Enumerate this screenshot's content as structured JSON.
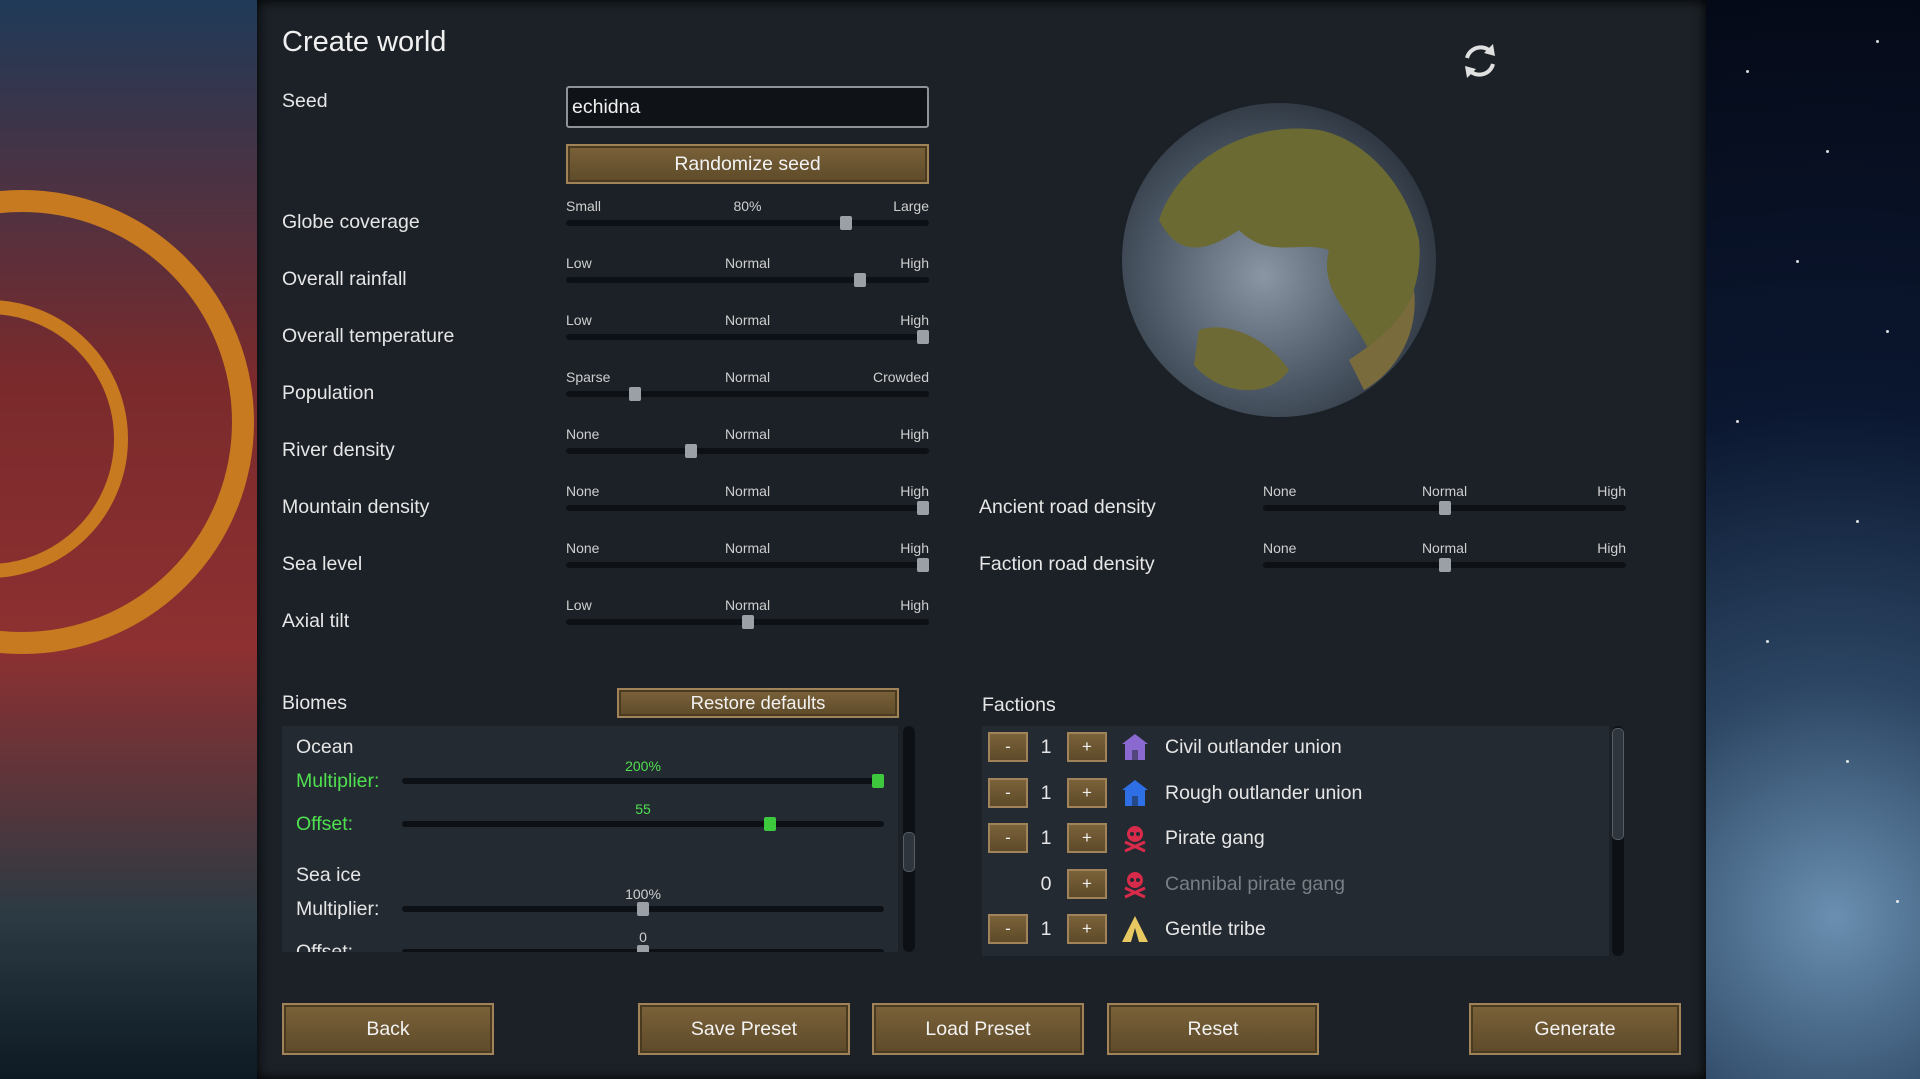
{
  "title": "Create world",
  "seed": {
    "label": "Seed",
    "value": "echidna",
    "randomize_label": "Randomize seed"
  },
  "sliders": [
    {
      "label": "Globe coverage",
      "low": "Small",
      "mid": "80%",
      "high": "Large",
      "value": 0.78
    },
    {
      "label": "Overall rainfall",
      "low": "Low",
      "mid": "Normal",
      "high": "High",
      "value": 0.82
    },
    {
      "label": "Overall temperature",
      "low": "Low",
      "mid": "Normal",
      "high": "High",
      "value": 1.0
    },
    {
      "label": "Population",
      "low": "Sparse",
      "mid": "Normal",
      "high": "Crowded",
      "value": 0.18
    },
    {
      "label": "River density",
      "low": "None",
      "mid": "Normal",
      "high": "High",
      "value": 0.34
    },
    {
      "label": "Mountain density",
      "low": "None",
      "mid": "Normal",
      "high": "High",
      "value": 1.0
    },
    {
      "label": "Sea level",
      "low": "None",
      "mid": "Normal",
      "high": "High",
      "value": 1.0
    },
    {
      "label": "Axial tilt",
      "low": "Low",
      "mid": "Normal",
      "high": "High",
      "value": 0.5
    }
  ],
  "road_sliders": [
    {
      "label": "Ancient road density",
      "low": "None",
      "mid": "Normal",
      "high": "High",
      "value": 0.5
    },
    {
      "label": "Faction road density",
      "low": "None",
      "mid": "Normal",
      "high": "High",
      "value": 0.5
    }
  ],
  "biomes": {
    "label": "Biomes",
    "restore_label": "Restore defaults",
    "items": [
      {
        "name": "Ocean",
        "multiplier_label": "Multiplier:",
        "multiplier_value": "200%",
        "multiplier_pos": 1.0,
        "offset_label": "Offset:",
        "offset_value": "55",
        "offset_pos": 0.77
      },
      {
        "name": "Sea ice",
        "multiplier_label": "Multiplier:",
        "multiplier_value": "100%",
        "multiplier_pos": 0.5,
        "offset_label": "Offset:",
        "offset_value": "0",
        "offset_pos": 0.5
      }
    ]
  },
  "factions": {
    "label": "Factions",
    "items": [
      {
        "name": "Civil outlander union",
        "count": "1",
        "icon": "house-icon",
        "color": "#8a6ad0",
        "disabled": false
      },
      {
        "name": "Rough outlander union",
        "count": "1",
        "icon": "house-icon",
        "color": "#2f6fe6",
        "disabled": false
      },
      {
        "name": "Pirate gang",
        "count": "1",
        "icon": "skull-icon",
        "color": "#d82a4a",
        "disabled": false
      },
      {
        "name": "Cannibal pirate gang",
        "count": "0",
        "icon": "skull-icon",
        "color": "#d82a4a",
        "disabled": true
      },
      {
        "name": "Gentle tribe",
        "count": "1",
        "icon": "tent-icon",
        "color": "#e8c860",
        "disabled": false
      }
    ],
    "minus": "-",
    "plus": "+"
  },
  "footer": {
    "back": "Back",
    "save_preset": "Save Preset",
    "load_preset": "Load Preset",
    "reset": "Reset",
    "generate": "Generate"
  }
}
